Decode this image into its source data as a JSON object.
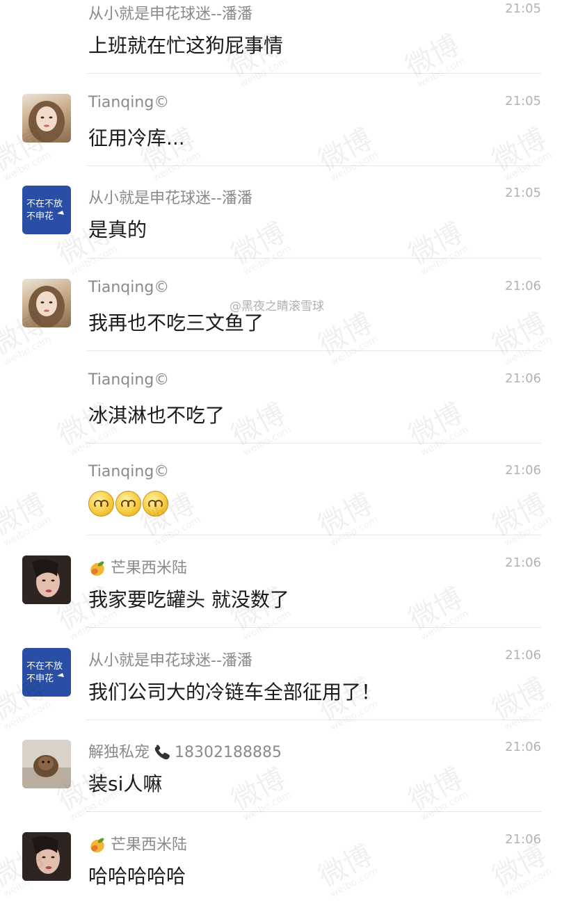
{
  "messages": [
    {
      "sender": "从小就是申花球迷--潘潘",
      "time": "21:05",
      "text": "上班就在忙这狗屁事情",
      "avatar": "none"
    },
    {
      "sender": "Tianqing©",
      "time": "21:05",
      "text": "征用冷库...",
      "avatar": "girl"
    },
    {
      "sender": "从小就是申花球迷--潘潘",
      "time": "21:05",
      "text": "是真的",
      "avatar": "blue"
    },
    {
      "sender": "Tianqing©",
      "time": "21:06",
      "text": "我再也不吃三文鱼了",
      "avatar": "girl"
    },
    {
      "sender": "Tianqing©",
      "time": "21:06",
      "text": "冰淇淋也不吃了",
      "avatar": "none"
    },
    {
      "sender": "Tianqing©",
      "time": "21:06",
      "text": "",
      "avatar": "none",
      "emoji_count": 3
    },
    {
      "sender": "芒果西米陆",
      "time": "21:06",
      "text": "我家要吃罐头 就没数了",
      "avatar": "dark",
      "sender_icon": "mango-icon"
    },
    {
      "sender": "从小就是申花球迷--潘潘",
      "time": "21:06",
      "text": "我们公司大的冷链车全部征用了！",
      "avatar": "blue"
    },
    {
      "sender": "解独私宠",
      "sender_phone": "18302188885",
      "time": "21:06",
      "text": "装si人嘛",
      "avatar": "dog",
      "sender_icon": "phone-icon"
    },
    {
      "sender": "芒果西米陆",
      "time": "21:06",
      "text": "哈哈哈哈哈",
      "avatar": "dark",
      "sender_icon": "mango-icon"
    }
  ],
  "watermark": {
    "text": "微博",
    "domain": "weibo.com",
    "credit": "@黑夜之睛滚雪球"
  },
  "colors": {
    "sender": "#8a8a8a",
    "time": "#b2b2b2",
    "text": "#1b1b1b",
    "separator": "#e6e6e6",
    "avatar_blue": "#2a4ea6"
  },
  "avatar_labels": {
    "blue_line1": "不在不放",
    "blue_line2": "不申花"
  }
}
